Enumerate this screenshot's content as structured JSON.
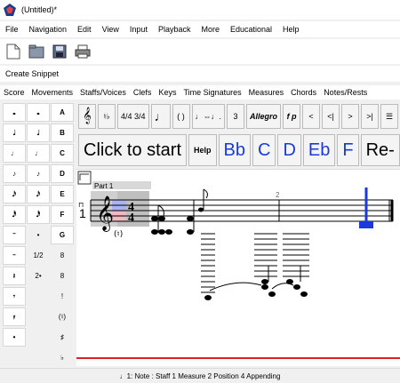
{
  "window": {
    "title": "(Untitled)*"
  },
  "menubar": [
    "File",
    "Navigation",
    "Edit",
    "View",
    "Input",
    "Playback",
    "More",
    "Educational",
    "Help"
  ],
  "toolbar": {
    "icons": [
      "new-file-icon",
      "open-folder-icon",
      "save-icon",
      "print-icon"
    ]
  },
  "snippet": {
    "label": "Create Snippet"
  },
  "tabs": [
    "Score",
    "Movements",
    "Staffs/Voices",
    "Clefs",
    "Keys",
    "Time Signatures",
    "Measures",
    "Chords",
    "Notes/Rests"
  ],
  "palette": {
    "col1": [
      "𝅝",
      "𝅗𝅥",
      "♩",
      "♪",
      "𝅘𝅥𝅯",
      "𝅘𝅥𝅰",
      "𝄻",
      "𝄼",
      "𝄽",
      "𝄾",
      "𝄿",
      "•"
    ],
    "col2": [
      "𝅝",
      "𝅗𝅥",
      "♩",
      "♪",
      "𝅘𝅥𝅯",
      "𝅘𝅥𝅰",
      "•",
      "1/2",
      "2•"
    ],
    "col3": [
      "A",
      "B",
      "C",
      "D",
      "E",
      "F",
      "G",
      "8",
      "8",
      "!",
      "(♮)",
      "♯",
      "♭"
    ]
  },
  "ribbon": [
    "𝄞",
    "♮♭",
    "4/4 3/4",
    "♩",
    "( )",
    "♩⇔♩.",
    "3",
    "Allegro",
    "f p",
    "<",
    "<|",
    ">",
    ">|",
    "☰"
  ],
  "bigrow": {
    "start": "Click to start",
    "help": "Help",
    "notes": [
      "Bb",
      "C",
      "D",
      "Eb",
      "F"
    ],
    "rest": "Re-"
  },
  "score": {
    "part_label": "Part 1",
    "measure_number": "2",
    "staff_number": "1",
    "time_sig": [
      "4",
      "4"
    ],
    "accidental": "(♮)"
  },
  "status": {
    "text": "1: Note : Staff 1 Measure 2 Position 4 Appending"
  },
  "colors": {
    "accent": "#1a3adb",
    "redline": "#d22222"
  }
}
